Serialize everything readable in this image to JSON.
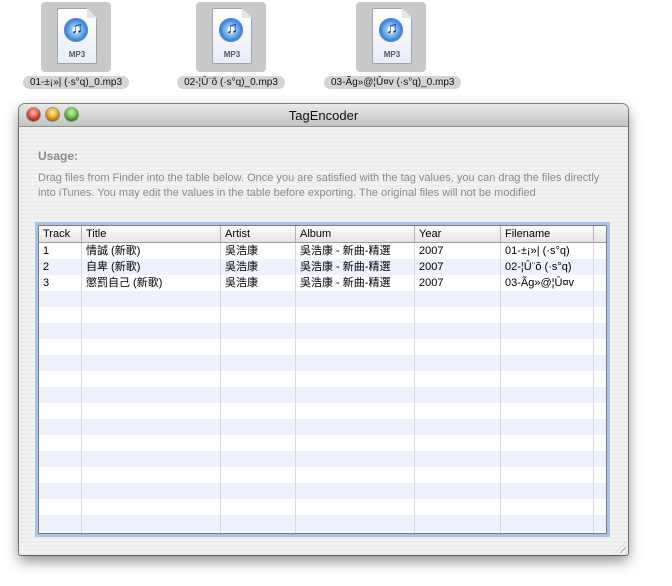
{
  "desktop": {
    "files": [
      {
        "icon": "mp3-file-icon",
        "badge": "MP3",
        "name": "01-±¡»|  (·s°q)_0.mp3"
      },
      {
        "icon": "mp3-file-icon",
        "badge": "MP3",
        "name": "02-¦Û¨õ (·s°q)_0.mp3"
      },
      {
        "icon": "mp3-file-icon",
        "badge": "MP3",
        "name": "03-Ãg»@¦Û¤v (·s°q)_0.mp3"
      }
    ]
  },
  "window": {
    "title": "TagEncoder",
    "usage_heading": "Usage:",
    "usage_text": "Drag files from Finder into the table below. Once you are satisfied with the tag values, you can drag the files directly into iTunes. You may edit the values in the table before exporting. The original files will not be modified"
  },
  "table": {
    "columns": [
      "Track",
      "Title",
      "Artist",
      "Album",
      "Year",
      "Filename"
    ],
    "rows": [
      {
        "track": "1",
        "title": "情誠 (新歌)",
        "artist": "吳浩康",
        "album": "吳浩康 - 新曲-精選",
        "year": "2007",
        "filename": "01-±¡»|  (·s°q)"
      },
      {
        "track": "2",
        "title": "自卑 (新歌)",
        "artist": "吳浩康",
        "album": "吳浩康 - 新曲-精選",
        "year": "2007",
        "filename": "02-¦Û¨õ (·s°q)"
      },
      {
        "track": "3",
        "title": "懲罰自己 (新歌)",
        "artist": "吳浩康",
        "album": "吳浩康 - 新曲-精選",
        "year": "2007",
        "filename": "03-Ãg»@¦Û¤v"
      }
    ]
  },
  "colors": {
    "selection_ring": "#a9c4ea",
    "stripe": "#edf3fe",
    "close": "#e0443a",
    "minimize": "#e6a218",
    "zoom": "#5fb936"
  }
}
